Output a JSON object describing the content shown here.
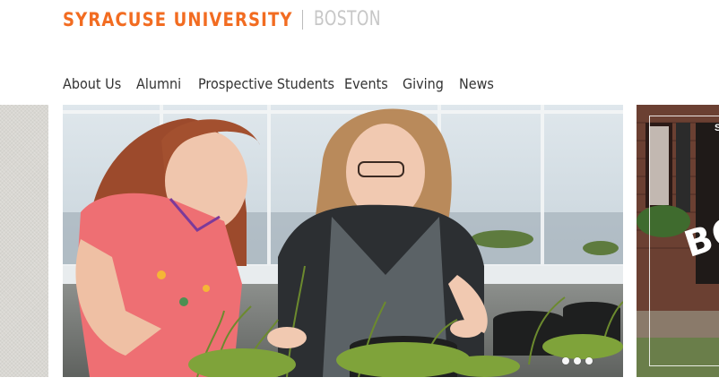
{
  "header": {
    "university_name": "SYRACUSE UNIVERSITY",
    "campus_name": "BOSTON",
    "brand_color": "#f26c21"
  },
  "nav": {
    "items": [
      {
        "label": "About Us"
      },
      {
        "label": "Alumni"
      },
      {
        "label": "Prospective Students"
      },
      {
        "label": "Events"
      },
      {
        "label": "Giving"
      },
      {
        "label": "News"
      }
    ]
  },
  "carousel": {
    "slide_count": 3,
    "next_slide_text": "BO",
    "next_slide_small_text": "S"
  }
}
